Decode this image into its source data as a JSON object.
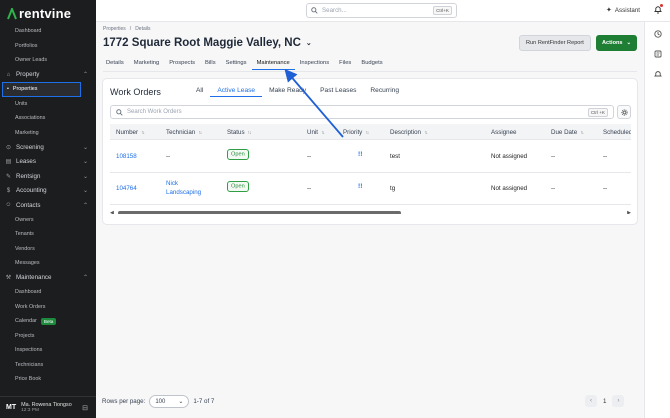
{
  "brand": {
    "name": "rentvine"
  },
  "topbar": {
    "search_placeholder": "Search...",
    "search_shortcut": "Ctrl+K",
    "assistant_label": "Assistant"
  },
  "sidebar": {
    "items": [
      {
        "label": "Dashboard",
        "kind": "item"
      },
      {
        "label": "Portfolios",
        "kind": "item"
      },
      {
        "label": "Owner Leads",
        "kind": "item"
      },
      {
        "label": "Property",
        "kind": "section",
        "icon": "home-icon"
      },
      {
        "label": "Properties",
        "kind": "active"
      },
      {
        "label": "Units",
        "kind": "item"
      },
      {
        "label": "Associations",
        "kind": "item"
      },
      {
        "label": "Marketing",
        "kind": "item"
      },
      {
        "label": "Screening",
        "kind": "section",
        "icon": "screening-icon"
      },
      {
        "label": "Leases",
        "kind": "section",
        "icon": "leases-icon"
      },
      {
        "label": "Rentsign",
        "kind": "section",
        "icon": "rentsign-icon"
      },
      {
        "label": "Accounting",
        "kind": "section",
        "icon": "accounting-icon"
      },
      {
        "label": "Contacts",
        "kind": "section",
        "icon": "contacts-icon"
      },
      {
        "label": "Owners",
        "kind": "item"
      },
      {
        "label": "Tenants",
        "kind": "item"
      },
      {
        "label": "Vendors",
        "kind": "item"
      },
      {
        "label": "Messages",
        "kind": "item"
      },
      {
        "label": "Maintenance",
        "kind": "section",
        "icon": "wrench-icon"
      },
      {
        "label": "Dashboard",
        "kind": "item"
      },
      {
        "label": "Work Orders",
        "kind": "item"
      },
      {
        "label": "Calendar",
        "kind": "item",
        "badge": "Beta"
      },
      {
        "label": "Projects",
        "kind": "item"
      },
      {
        "label": "Inspections",
        "kind": "item"
      },
      {
        "label": "Technicians",
        "kind": "item"
      },
      {
        "label": "Price Book",
        "kind": "item"
      }
    ]
  },
  "user": {
    "initials": "MT",
    "name": "Ma. Rowena Tiongso",
    "time": "12:3 PM"
  },
  "breadcrumb": [
    "Properties",
    "/",
    "Details"
  ],
  "page": {
    "title": "1772 Square Root Maggie Valley, NC",
    "run_report_label": "Run RentFinder Report",
    "actions_label": "Actions"
  },
  "tabs": [
    "Details",
    "Marketing",
    "Prospects",
    "Bills",
    "Settings",
    "Maintenance",
    "Inspections",
    "Files",
    "Budgets"
  ],
  "active_tab": "Maintenance",
  "work_orders": {
    "title": "Work Orders",
    "filters": [
      "All",
      "Active Lease",
      "Make Ready",
      "Past Leases",
      "Recurring"
    ],
    "active_filter": "Active Lease",
    "search_placeholder": "Search Work Orders",
    "search_shortcut": "Ctrl +K",
    "columns": [
      "Number",
      "Technician",
      "Status",
      "Unit",
      "Priority",
      "Description",
      "Assignee",
      "Due Date",
      "Scheduled"
    ],
    "rows": [
      {
        "number": "108158",
        "technician": "--",
        "technician_2": "",
        "status": "Open",
        "unit": "--",
        "priority": "!!",
        "description": "test",
        "assignee": "Not assigned",
        "due": "--",
        "scheduled": "--"
      },
      {
        "number": "104764",
        "technician": "Nick",
        "technician_2": "Landscaping",
        "status": "Open",
        "unit": "--",
        "priority": "!!",
        "description": "tg",
        "assignee": "Not assigned",
        "due": "--",
        "scheduled": "--"
      }
    ]
  },
  "pagination": {
    "rows_label": "Rows per page:",
    "rows_value": "100",
    "range": "1-7 of 7",
    "current_page": "1"
  },
  "colors": {
    "accent": "#1e6fe8",
    "actions_green": "#1e7e34",
    "sidebar_bg": "#1c1d1f"
  }
}
